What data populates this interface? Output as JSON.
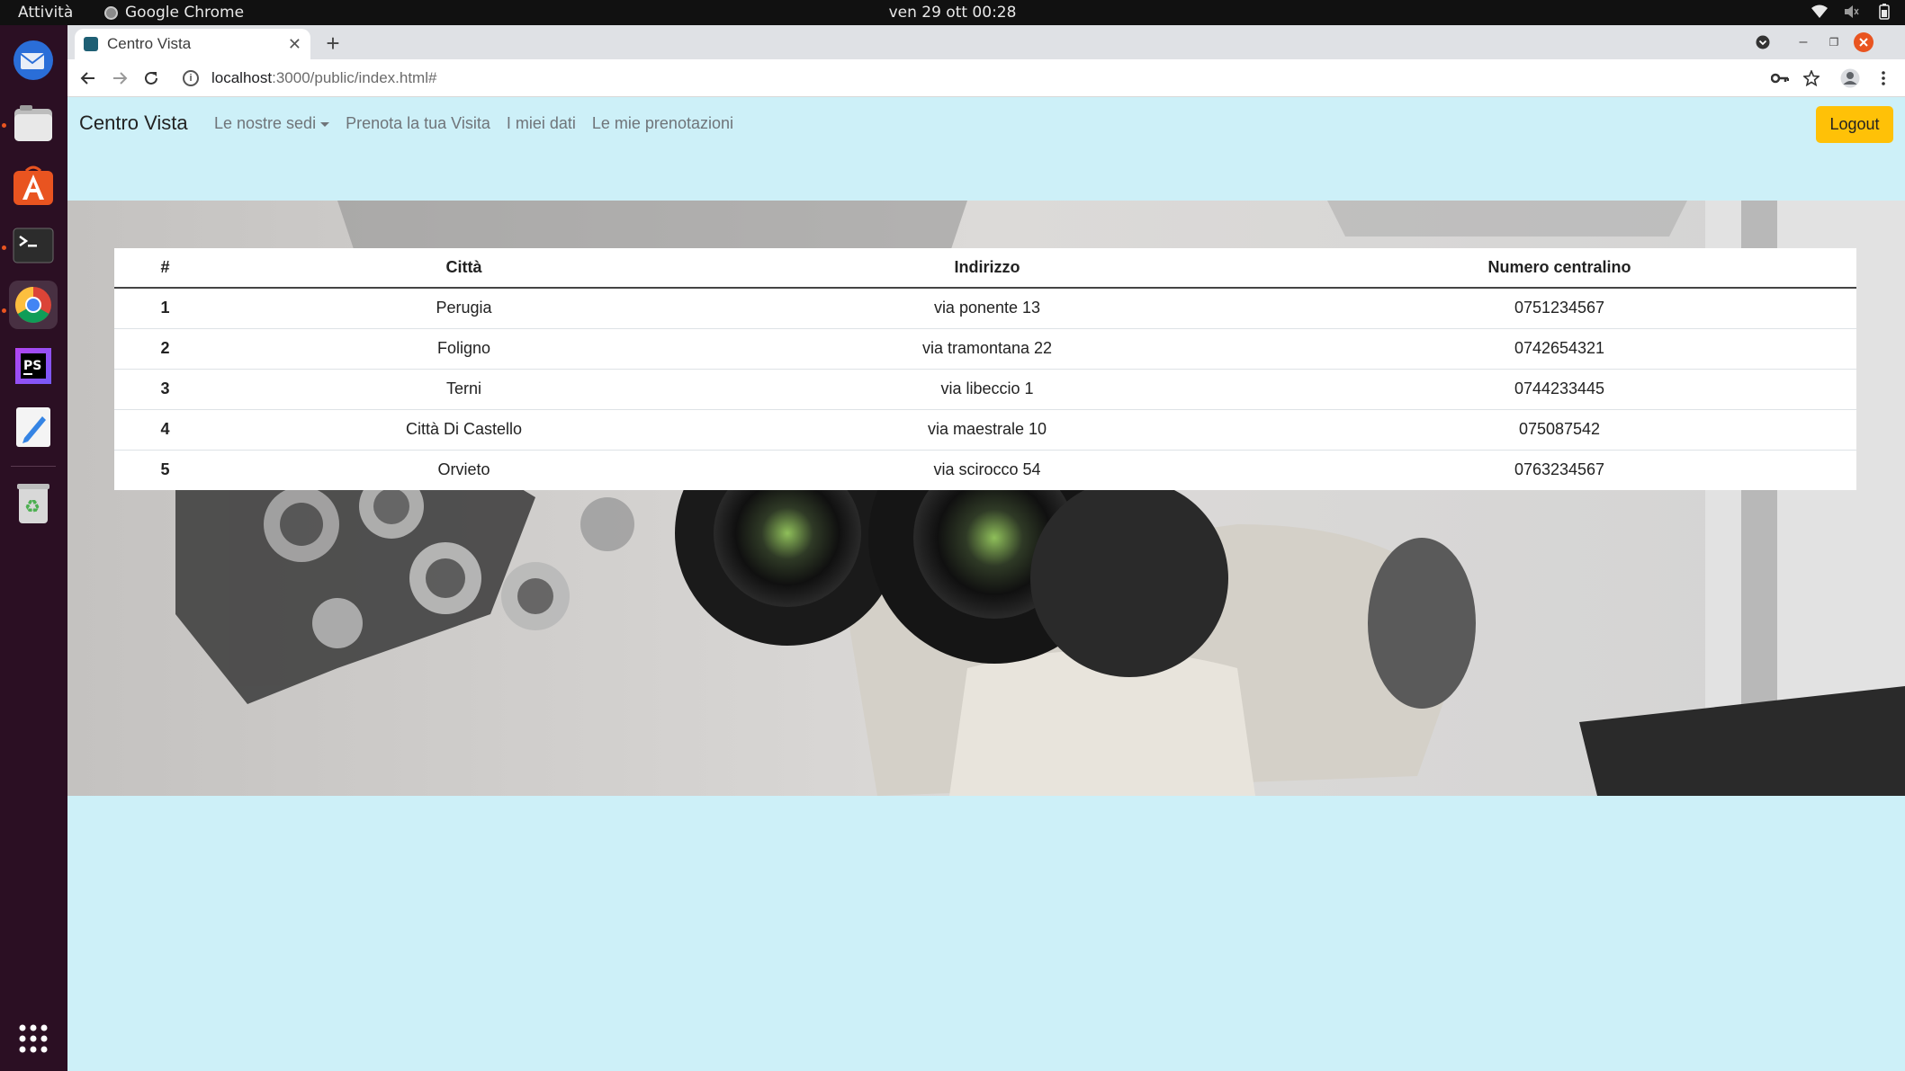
{
  "desktop": {
    "activities": "Attività",
    "app_name": "Google Chrome",
    "clock": "ven 29 ott  00:28"
  },
  "browser": {
    "tab_title": "Centro Vista",
    "url_host": "localhost",
    "url_path": ":3000/public/index.html#"
  },
  "navbar": {
    "brand": "Centro Vista",
    "links": [
      {
        "label": "Le nostre sedi"
      },
      {
        "label": "Prenota la tua Visita"
      },
      {
        "label": "I miei dati"
      },
      {
        "label": "Le mie prenotazioni"
      }
    ],
    "logout": "Logout"
  },
  "table": {
    "headers": [
      "#",
      "Città",
      "Indirizzo",
      "Numero centralino"
    ],
    "rows": [
      {
        "num": "1",
        "city": "Perugia",
        "address": "via ponente 13",
        "phone": "0751234567"
      },
      {
        "num": "2",
        "city": "Foligno",
        "address": "via tramontana 22",
        "phone": "0742654321"
      },
      {
        "num": "3",
        "city": "Terni",
        "address": "via libeccio 1",
        "phone": "0744233445"
      },
      {
        "num": "4",
        "city": "Città Di Castello",
        "address": "via maestrale 10",
        "phone": "075087542"
      },
      {
        "num": "5",
        "city": "Orvieto",
        "address": "via scirocco 54",
        "phone": "0763234567"
      }
    ]
  },
  "colors": {
    "page_bg": "#cdf0f8",
    "logout_bg": "#ffc107",
    "dock_bg": "#2b0f23"
  }
}
